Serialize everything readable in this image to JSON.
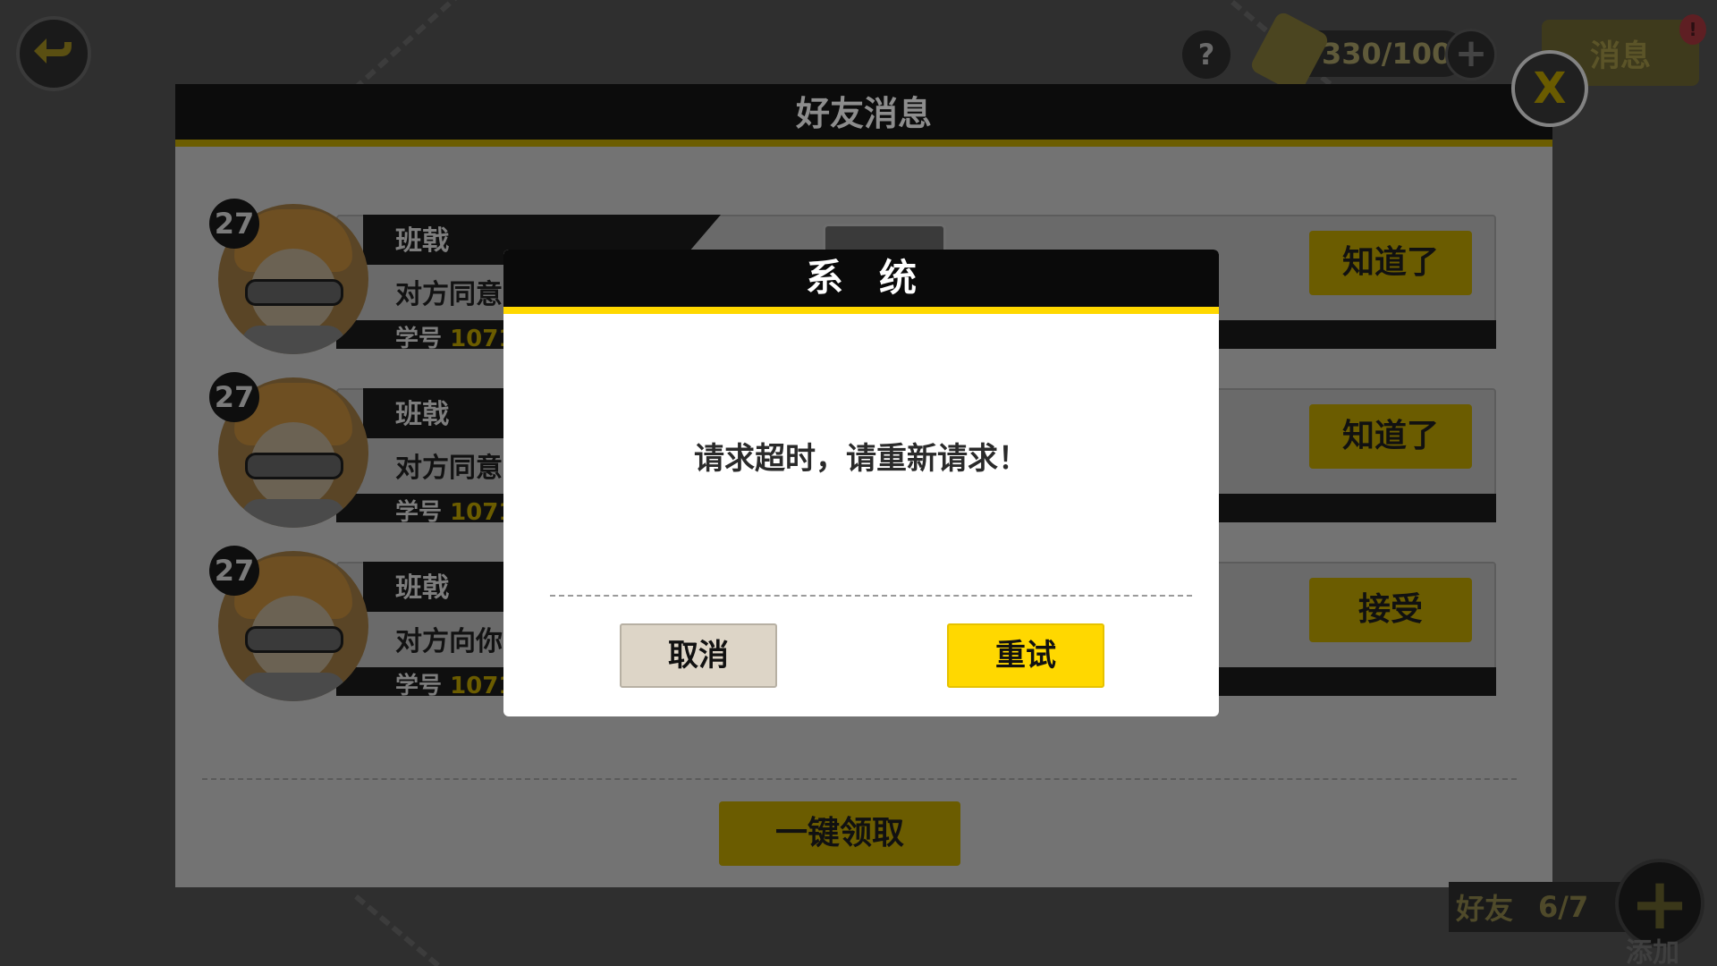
{
  "hud": {
    "help_label": "?",
    "stamina_text": "330/100",
    "plus_label": "+",
    "message_tab_label": "消息",
    "alert_badge": "!"
  },
  "panel": {
    "title": "好友消息",
    "close_label": "X",
    "claim_all_label": "一键领取",
    "rows": [
      {
        "level": "27",
        "name": "班戟",
        "desc": "对方同意",
        "id_label": "学号",
        "id_value": "1071",
        "action": "知道了"
      },
      {
        "level": "27",
        "name": "班戟",
        "desc": "对方同意",
        "id_label": "学号",
        "id_value": "1071",
        "action": "知道了"
      },
      {
        "level": "27",
        "name": "班戟",
        "desc": "对方向你",
        "id_label": "学号",
        "id_value": "1071",
        "action": "接受"
      }
    ]
  },
  "friends": {
    "label": "好友",
    "count": "6/7",
    "add_label": "添加"
  },
  "dialog": {
    "title": "系统",
    "message": "请求超时，请重新请求！",
    "cancel_label": "取消",
    "retry_label": "重试"
  },
  "colors": {
    "accent_yellow": "#ffd800",
    "dimmed_yellow": "#6b5c00",
    "cancel_beige": "#ddd5c7"
  }
}
